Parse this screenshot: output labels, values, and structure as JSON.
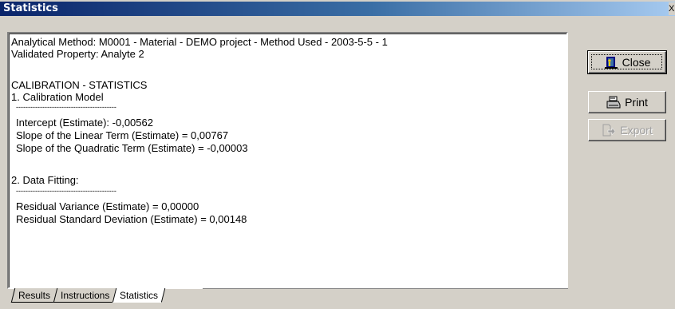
{
  "window": {
    "title": "Statistics",
    "close_glyph": "X"
  },
  "report": {
    "lines": [
      "Analytical Method: M0001 - Material - DEMO project - Method Used - 2003-5-5 - 1",
      "Validated Property: Analyte 2",
      "",
      "CALIBRATION - STATISTICS",
      "1. Calibration Model",
      "------------------------------------------",
      "Intercept (Estimate): -0,00562",
      "Slope of the Linear Term (Estimate) = 0,00767",
      "Slope of the Quadratic Term (Estimate) = -0,00003",
      "",
      "2. Data Fitting:",
      "------------------------------------------",
      "Residual Variance (Estimate) = 0,00000",
      "Residual Standard Deviation (Estimate) = 0,00148"
    ]
  },
  "buttons": {
    "close_label": "Close",
    "print_label": "Print",
    "export_label": "Export"
  },
  "tabs": [
    {
      "label": "Results"
    },
    {
      "label": "Instructions"
    },
    {
      "label": "Statistics",
      "active": true
    }
  ]
}
